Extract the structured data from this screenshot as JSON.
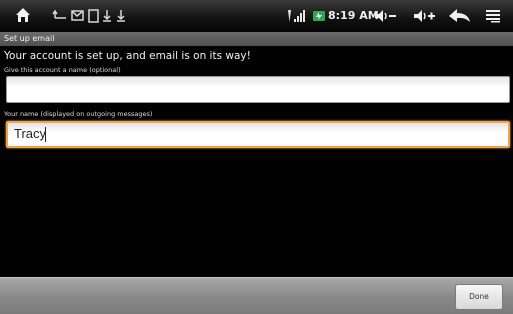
{
  "status_bar": {
    "icons": [
      "home-icon",
      "usb-notification-icon",
      "gmail-notification-icon",
      "sd-card-notification-icon",
      "download-notification-icon",
      "wifi-signal-icon",
      "battery-icon",
      "volume-down-icon",
      "volume-up-icon",
      "back-icon",
      "menu-icon"
    ],
    "time": "8:19 AM"
  },
  "title_bar": {
    "title": "Set up email"
  },
  "main": {
    "heading": "Your account is set up, and email is on its way!",
    "account_name_label": "Give this account a name (optional)",
    "account_name_value": "",
    "your_name_label": "Your name (displayed on outgoing messages)",
    "your_name_value": "Tracy"
  },
  "bottom_bar": {
    "done_label": "Done"
  },
  "colors": {
    "focus_accent": "#f2a24a",
    "background": "#020202"
  }
}
